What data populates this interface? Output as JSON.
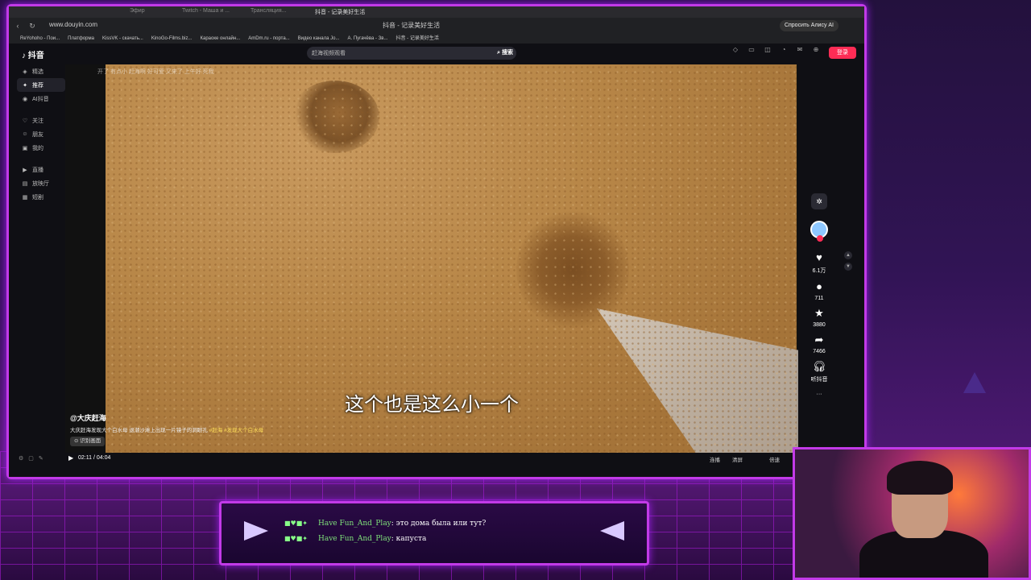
{
  "browser": {
    "tabs": [
      "Эфир",
      "Twitch - Маша и ...",
      "Трансляция...",
      "抖音 - 记录美好生活"
    ],
    "url": "www.douyin.com",
    "page_title": "抖音 - 记录美好生活",
    "ask_alice": "Спросить Алису AI",
    "bookmarks": [
      "ReYohoho - Пои...",
      "Платформа",
      "KissVK - скачать...",
      "KinoGo-Films.biz...",
      "Караоке онлайн...",
      "AmDm.ru - порта...",
      "Видео канала Jo...",
      "А. Пугачёва - Зв...",
      "抖音 - 记录美好生活"
    ]
  },
  "douyin": {
    "logo": "抖音",
    "search_placeholder": "赶海视频观看",
    "search_button": "搜索",
    "login": "登录",
    "sidebar": [
      {
        "icon": "◈",
        "label": "精选"
      },
      {
        "icon": "✦",
        "label": "推荐",
        "active": true
      },
      {
        "icon": "◉",
        "label": "AI抖音"
      },
      {
        "icon": "♡",
        "label": "关注"
      },
      {
        "icon": "☺",
        "label": "朋友"
      },
      {
        "icon": "▣",
        "label": "我的"
      },
      {
        "icon": "▶",
        "label": "直播"
      },
      {
        "icon": "▤",
        "label": "放映厅"
      },
      {
        "icon": "▦",
        "label": "短剧"
      }
    ],
    "video": {
      "subtitle": "这个也是这么小一个",
      "author": "@大庆赶海",
      "caption": "大庆赶海发现大个白水母 退潮沙滩上出现一片镜子的洞眼孔",
      "caption_tags": "#赶海 #发现大个白水母",
      "recognize": "识别画面",
      "danmaku": "开了    有点小    赶海啊    好可爱    又来了    上午好    死我"
    },
    "actions": {
      "likes": "6.1万",
      "comments": "711",
      "favorites": "3880",
      "shares": "7466",
      "listen": "听抖音",
      "more": "···"
    },
    "player": {
      "time": "02:11 / 04:04",
      "chips": [
        "连播",
        "清屏",
        "倍速"
      ]
    }
  },
  "chat": {
    "messages": [
      {
        "user": "Have Fun_And_Play",
        "text": "это дома была или тут?"
      },
      {
        "user": "Have Fun_And_Play",
        "text": "капуста"
      }
    ]
  }
}
